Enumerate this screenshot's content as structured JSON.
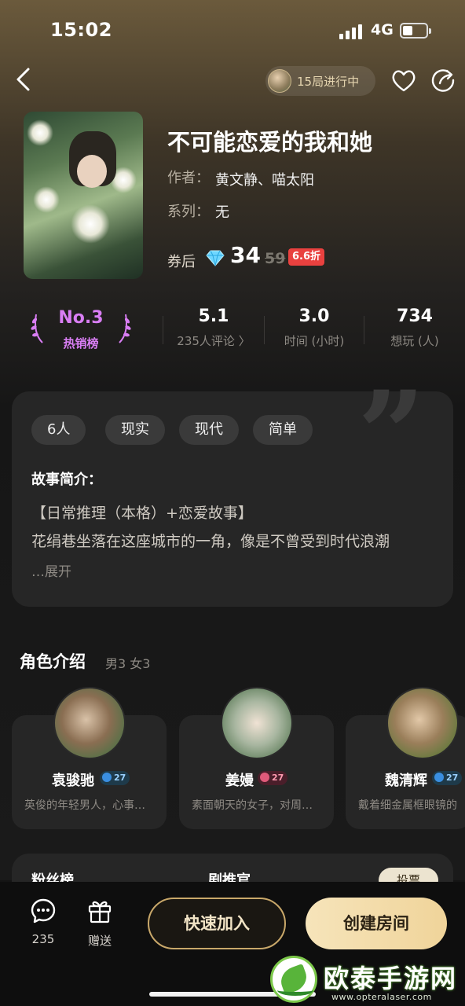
{
  "status_bar": {
    "time": "15:02",
    "network": "4G"
  },
  "nav": {
    "live_label": "15局进行中"
  },
  "game": {
    "title": "不可能恋爱的我和她",
    "author_label": "作者：",
    "author": "黄文静、喵太阳",
    "series_label": "系列：",
    "series": "无",
    "price_label": "券后",
    "price": "34",
    "original_price": "59",
    "discount": "6.6折"
  },
  "stats": {
    "rank_number": "No.3",
    "rank_label": "热销榜",
    "rating": "5.1",
    "reviews": "235人评论 〉",
    "duration": "3.0",
    "duration_label": "时间 (小时)",
    "wants": "734",
    "wants_label": "想玩 (人)"
  },
  "intro": {
    "tags": [
      "6人",
      "现实",
      "现代",
      "简单"
    ],
    "heading": "故事简介：",
    "lines": [
      "【日常推理（本格）+恋爱故事】",
      "花绢巷坐落在这座城市的一角，像是不曾受到时代浪潮"
    ],
    "expand": "…展开"
  },
  "characters": {
    "title": "角色介绍",
    "summary": "男3 女3",
    "items": [
      {
        "name": "袁骏驰",
        "gender": "m",
        "age": "27",
        "desc": "英俊的年轻男人，心事…"
      },
      {
        "name": "姜嫚",
        "gender": "f",
        "age": "27",
        "desc": "素面朝天的女子，对周…"
      },
      {
        "name": "魏清辉",
        "gender": "m",
        "age": "27",
        "desc": "戴着细金属框眼镜的"
      }
    ]
  },
  "peek": {
    "left_label": "粉丝榜",
    "mid_label": "剧推官",
    "button": "投票"
  },
  "bottom": {
    "comments_count": "235",
    "gift_label": "赠送",
    "join_label": "快速加入",
    "create_label": "创建房间"
  },
  "watermark": {
    "text": "欧泰手游网",
    "url": "www.opteralaser.com"
  },
  "colors": {
    "rank": "#d97ef4",
    "discount": "#e9413f",
    "accent_gold": "#f0d49a"
  }
}
